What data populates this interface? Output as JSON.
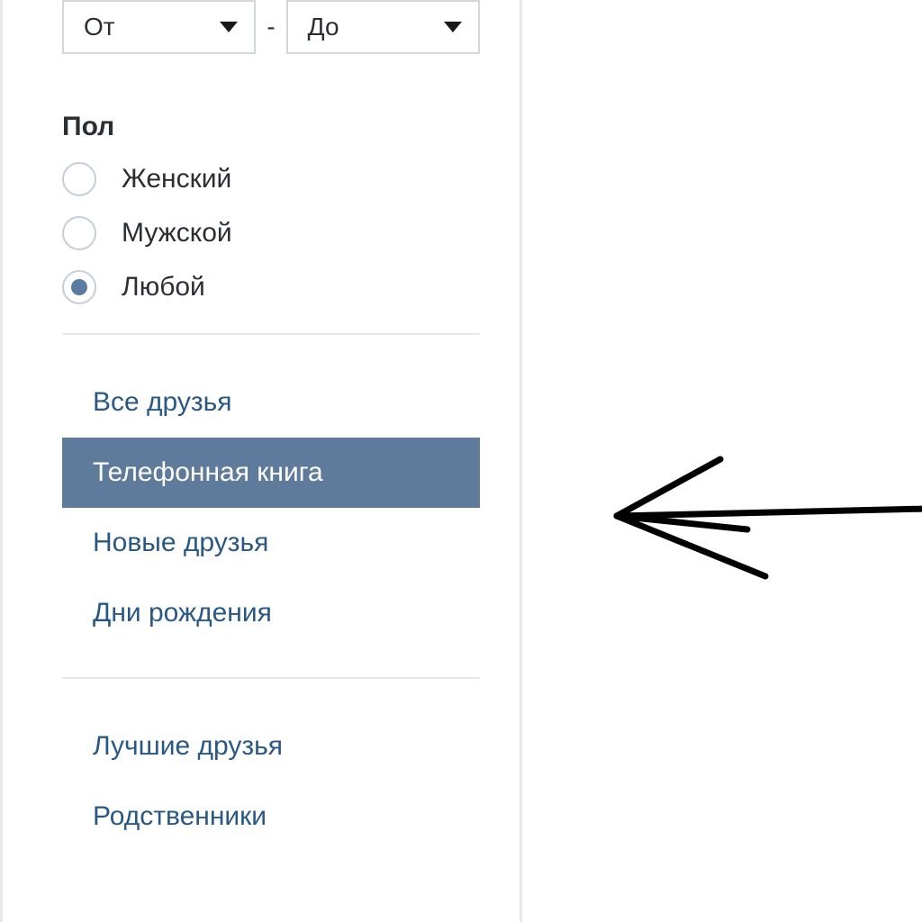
{
  "age_range": {
    "from_label": "От",
    "to_label": "До",
    "separator": "-"
  },
  "gender": {
    "label": "Пол",
    "options": [
      {
        "label": "Женский",
        "selected": false
      },
      {
        "label": "Мужской",
        "selected": false
      },
      {
        "label": "Любой",
        "selected": true
      }
    ]
  },
  "nav_sections": {
    "primary": [
      {
        "label": "Все друзья",
        "selected": false
      },
      {
        "label": "Телефонная книга",
        "selected": true
      },
      {
        "label": "Новые друзья",
        "selected": false
      },
      {
        "label": "Дни рождения",
        "selected": false
      }
    ],
    "secondary": [
      {
        "label": "Лучшие друзья"
      },
      {
        "label": "Родственники"
      }
    ]
  }
}
